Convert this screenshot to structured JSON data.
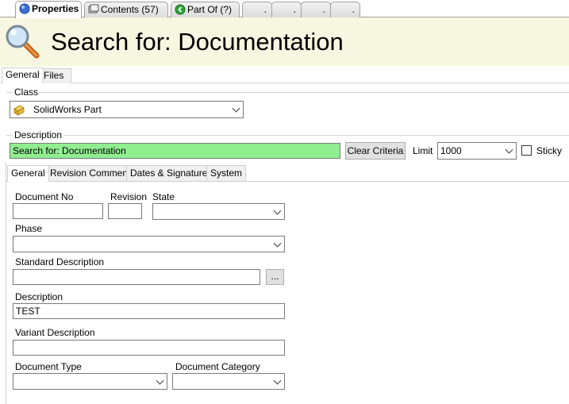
{
  "top_tabs": [
    {
      "label": "Properties",
      "icon": "properties-icon"
    },
    {
      "label": "Contents (57)",
      "icon": "contents-icon"
    },
    {
      "label": "Part Of (?)",
      "icon": "part-of-icon"
    },
    {
      "label": "."
    },
    {
      "label": "."
    },
    {
      "label": "."
    },
    {
      "label": "."
    }
  ],
  "header": {
    "title": "Search for: Documentation",
    "icon": "magnifier-icon"
  },
  "sub_tabs": [
    "General",
    "Files"
  ],
  "class_section": {
    "label": "Class",
    "value": "SolidWorks Part",
    "icon": "solidworks-part-icon"
  },
  "description_section": {
    "label": "Description",
    "value": "Search for: Documentation",
    "clear_button": "Clear Criteria",
    "limit_label": "Limit",
    "limit_value": "1000",
    "sticky_label": "Sticky",
    "highlight_color": "#90ee90"
  },
  "inner_tabs": [
    "General",
    "Revision Comment",
    "Dates & Signatures",
    "System"
  ],
  "form": {
    "document_no": {
      "label": "Document No",
      "value": ""
    },
    "revision": {
      "label": "Revision",
      "value": ""
    },
    "state": {
      "label": "State",
      "value": ""
    },
    "phase": {
      "label": "Phase",
      "value": ""
    },
    "standard_description": {
      "label": "Standard Description",
      "value": "",
      "browse": "..."
    },
    "description": {
      "label": "Description",
      "value": "TEST"
    },
    "variant_description": {
      "label": "Variant Description",
      "value": ""
    },
    "document_type": {
      "label": "Document Type",
      "value": ""
    },
    "document_category": {
      "label": "Document Category",
      "value": ""
    }
  }
}
